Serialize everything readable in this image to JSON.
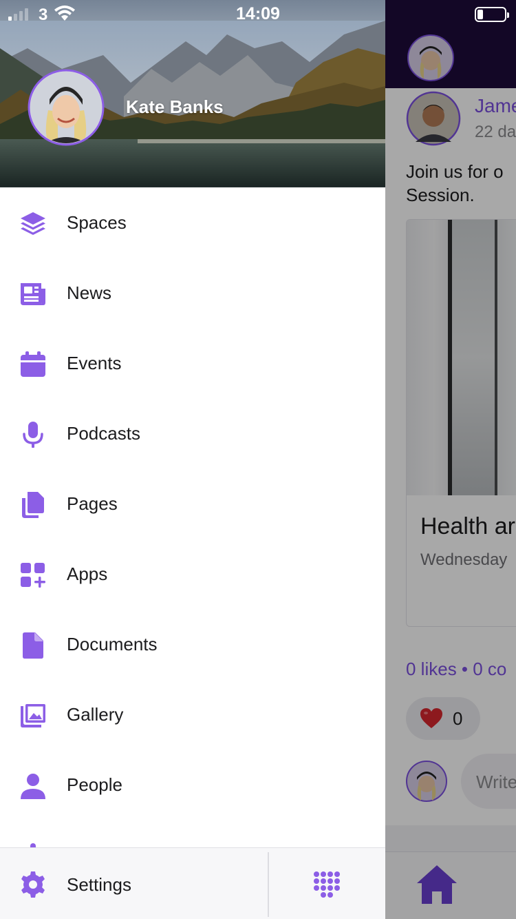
{
  "status_bar": {
    "carrier": "3",
    "time": "14:09",
    "battery_level": 0.2
  },
  "drawer": {
    "profile": {
      "name": "Kate Banks",
      "avatar_icon": "user-avatar"
    },
    "menu": [
      {
        "label": "Spaces",
        "icon": "layers-icon"
      },
      {
        "label": "News",
        "icon": "newspaper-icon"
      },
      {
        "label": "Events",
        "icon": "calendar-icon"
      },
      {
        "label": "Podcasts",
        "icon": "microphone-icon"
      },
      {
        "label": "Pages",
        "icon": "pages-icon"
      },
      {
        "label": "Apps",
        "icon": "apps-add-icon"
      },
      {
        "label": "Documents",
        "icon": "document-icon"
      },
      {
        "label": "Gallery",
        "icon": "gallery-icon"
      },
      {
        "label": "People",
        "icon": "person-icon"
      }
    ],
    "footer": {
      "settings_label": "Settings",
      "settings_icon": "gear-icon",
      "grid_icon": "dots-grid-icon"
    },
    "accent_color": "#8c5ee6"
  },
  "feed": {
    "post": {
      "author": "Jame",
      "time": "22 da",
      "text": "Join us for o\nSession.",
      "event_title": "Health ar",
      "event_date": "Wednesday",
      "stats": "0 likes • 0 co",
      "reaction_count": "0",
      "comment_placeholder": "Write"
    },
    "accent_color": "#7b50e0",
    "topbar_color": "#1d0b3b"
  }
}
